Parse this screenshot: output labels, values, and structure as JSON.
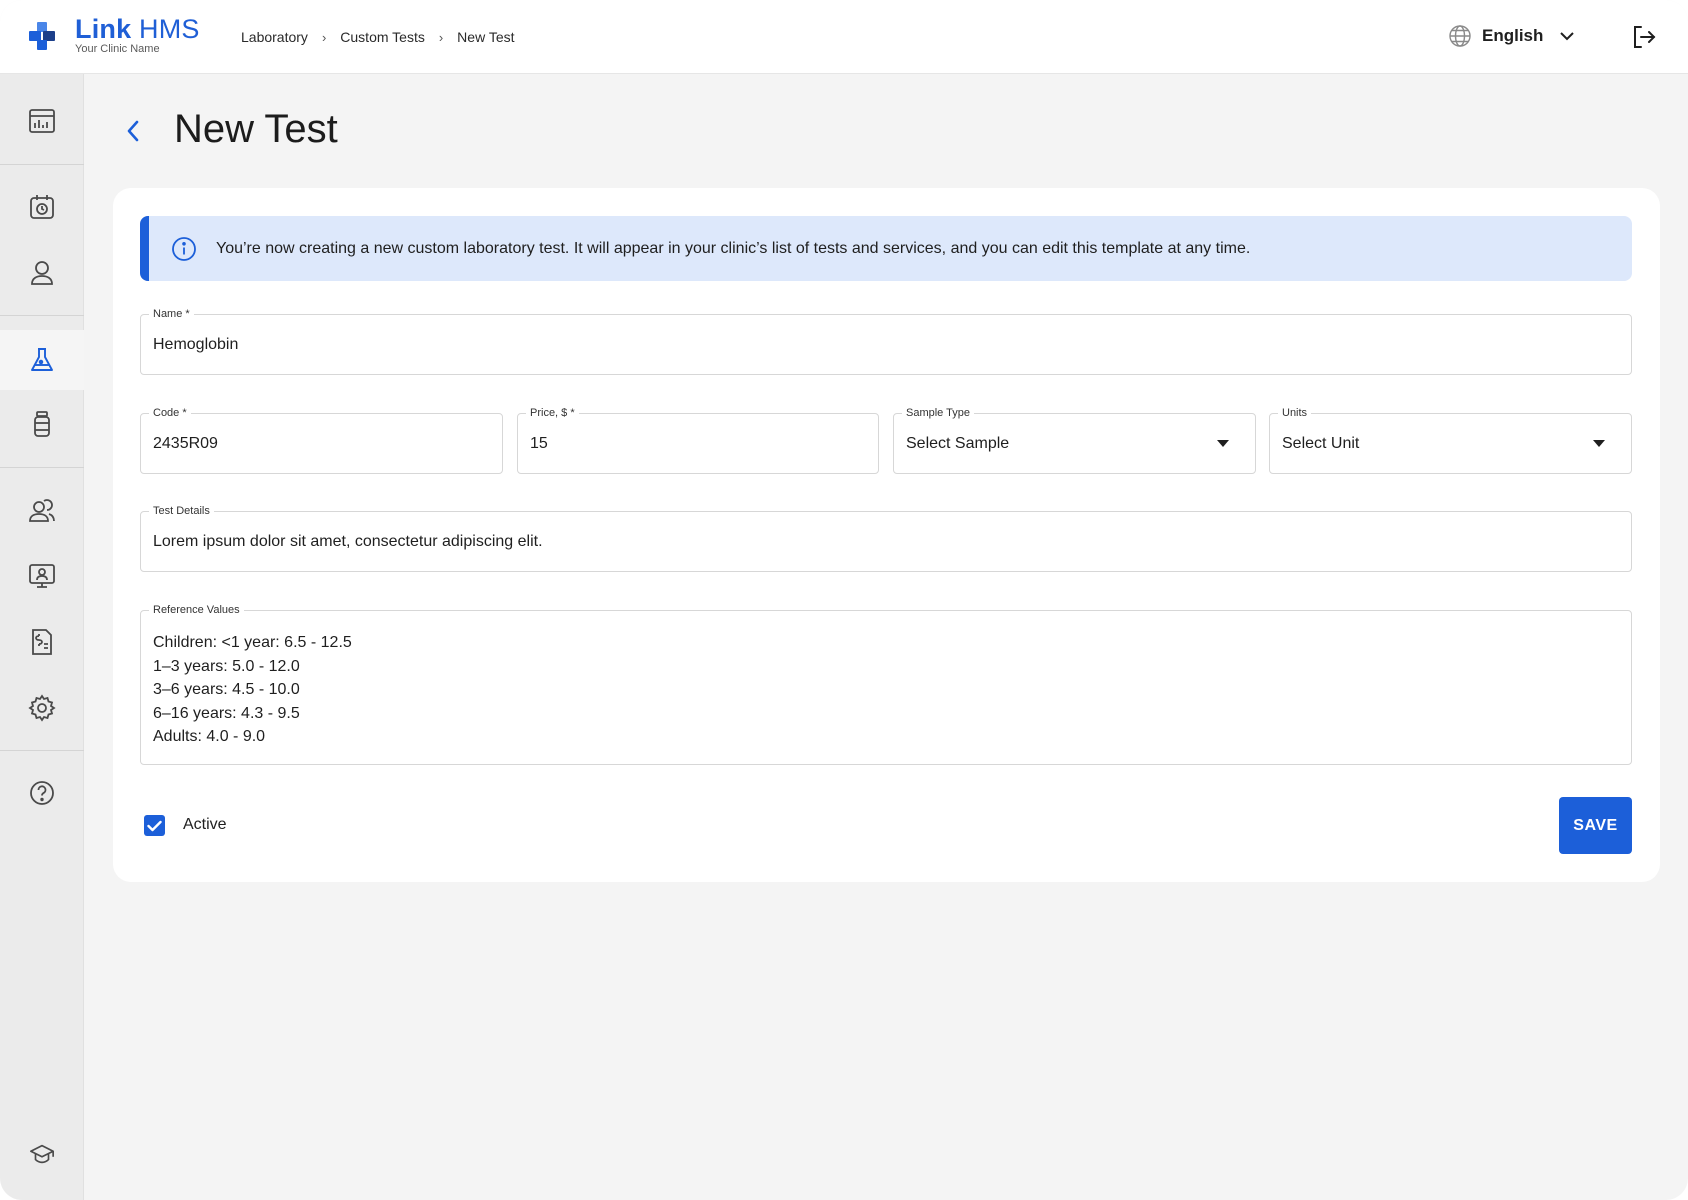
{
  "brand": {
    "name_bold": "Link",
    "name_light": "HMS",
    "subtitle": "Your Clinic Name"
  },
  "breadcrumb": [
    "Laboratory",
    "Custom Tests",
    "New Test"
  ],
  "header": {
    "language": "English"
  },
  "page": {
    "title": "New Test"
  },
  "info": {
    "text": "You’re now creating a new custom laboratory test. It will appear in your clinic’s list of tests and services, and you can edit this template at any time."
  },
  "form": {
    "name": {
      "label": "Name *",
      "value": "Hemoglobin"
    },
    "code": {
      "label": "Code *",
      "value": "2435R09"
    },
    "price": {
      "label": "Price, $ *",
      "value": "15"
    },
    "sample_type": {
      "label": "Sample Type",
      "value": "Select Sample"
    },
    "units": {
      "label": "Units",
      "value": "Select Unit"
    },
    "details": {
      "label": "Test Details",
      "value": "Lorem ipsum dolor sit amet, consectetur adipiscing elit."
    },
    "reference": {
      "label": "Reference Values",
      "lines": [
        "Children: <1 year: 6.5 - 12.5",
        "1–3 years: 5.0 - 12.0",
        "3–6 years: 4.5 - 10.0",
        "6–16 years: 4.3 - 9.5",
        "Adults: 4.0 - 9.0"
      ]
    },
    "active_label": "Active",
    "save_label": "SAVE"
  },
  "sidebar_icons": [
    "dashboard-icon",
    "appointments-icon",
    "patients-icon",
    "laboratory-icon",
    "pharmacy-icon",
    "staff-icon",
    "telemedicine-icon",
    "billing-icon",
    "settings-icon",
    "help-icon",
    "education-icon"
  ],
  "colors": {
    "accent": "#1c5fd9",
    "info_bg": "#dde8fb"
  }
}
